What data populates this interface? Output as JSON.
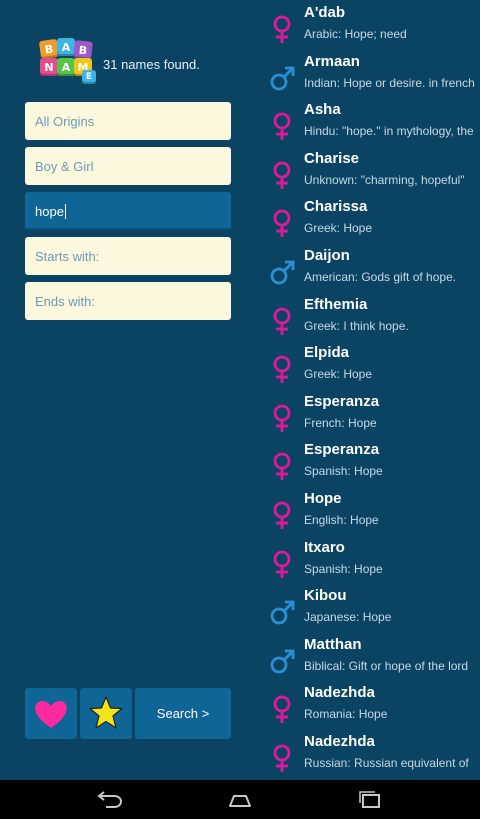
{
  "header": {
    "logo_text": "BABY NAME",
    "count_text": "31 names found."
  },
  "filters": {
    "origin": "All Origins",
    "gender": "Boy & Girl",
    "query": "hope",
    "starts_with_placeholder": "Starts with:",
    "ends_with_placeholder": "Ends with:"
  },
  "toolbar": {
    "search_label": "Search >"
  },
  "colors": {
    "female": "#e0189e",
    "male": "#2a90d6",
    "heart": "#ff2aa0",
    "star": "#f4e21c"
  },
  "results": [
    {
      "name": "A'dab",
      "desc": "Arabic: Hope; need",
      "gender": "female"
    },
    {
      "name": "Armaan",
      "desc": "Indian: Hope or desire. in french",
      "gender": "male"
    },
    {
      "name": "Asha",
      "desc": "Hindu: \"hope.\" in mythology, the",
      "gender": "female"
    },
    {
      "name": "Charise",
      "desc": "Unknown: \"charming, hopeful\"",
      "gender": "female"
    },
    {
      "name": "Charissa",
      "desc": "Greek: Hope",
      "gender": "female"
    },
    {
      "name": "Daijon",
      "desc": "American: Gods gift of hope.",
      "gender": "male"
    },
    {
      "name": "Efthemia",
      "desc": "Greek: I think hope.",
      "gender": "female"
    },
    {
      "name": "Elpida",
      "desc": "Greek: Hope",
      "gender": "female"
    },
    {
      "name": "Esperanza",
      "desc": "French: Hope",
      "gender": "female"
    },
    {
      "name": "Esperanza",
      "desc": "Spanish: Hope",
      "gender": "female"
    },
    {
      "name": "Hope",
      "desc": "English: Hope",
      "gender": "female"
    },
    {
      "name": "Itxaro",
      "desc": "Spanish: Hope",
      "gender": "female"
    },
    {
      "name": "Kibou",
      "desc": "Japanese: Hope",
      "gender": "male"
    },
    {
      "name": "Matthan",
      "desc": "Biblical: Gift or hope of the lord",
      "gender": "male"
    },
    {
      "name": "Nadezhda",
      "desc": "Romania: Hope",
      "gender": "female"
    },
    {
      "name": "Nadezhda",
      "desc": "Russian: Russian equivalent of",
      "gender": "female"
    }
  ]
}
